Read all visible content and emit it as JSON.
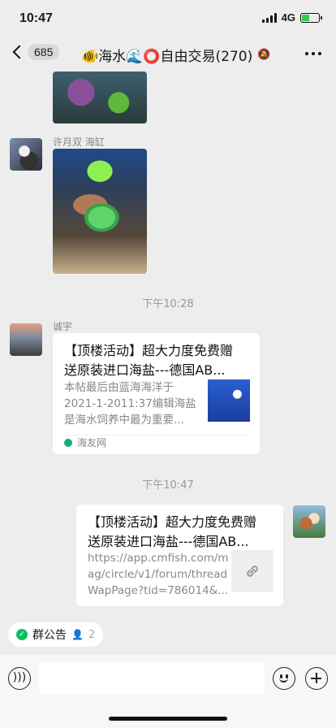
{
  "status_bar": {
    "time": "10:47",
    "network": "4G"
  },
  "nav": {
    "unread_count": "685",
    "title": "🐠海水🌊⭕自由交易(270)"
  },
  "messages": [
    {
      "sender": "许月双 海缸"
    },
    {
      "sender": "诚宇"
    }
  ],
  "timestamps": [
    "下午10:28",
    "下午10:47"
  ],
  "link_card_1": {
    "title_line1": "【顶楼活动】超大力度免费赠",
    "title_line2": "送原装进口海盐---德国AB...",
    "desc_line1": "本帖最后由蓝海海洋于",
    "desc_line2": "2021-1-2011:37编辑海盐",
    "desc_line3": "是海水饲养中最为重要...",
    "source": "海友网"
  },
  "link_card_2": {
    "title_line1": "【顶楼活动】超大力度免费赠",
    "title_line2": "送原装进口海盐---德国AB...",
    "desc_line1": "https://app.cmfish.com/m",
    "desc_line2": "ag/circle/v1/forum/thread",
    "desc_line3": "WapPage?tid=786014&..."
  },
  "notice": {
    "label": "群公告",
    "count": "2"
  }
}
